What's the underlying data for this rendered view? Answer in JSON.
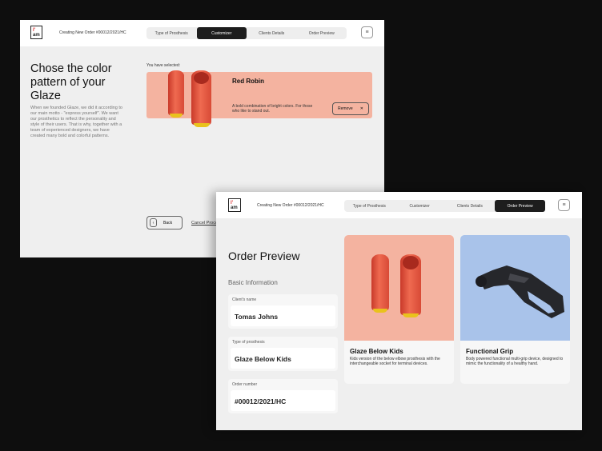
{
  "window1": {
    "logo": "I'am",
    "order_title": "Creating New Order #00012/2021/HC",
    "tabs": [
      "Type of Prosthesis",
      "Customizer",
      "Clients Details",
      "Order Preview"
    ],
    "active_tab": "Customizer",
    "heading": "Chose the color pattern of your Glaze",
    "paragraph": "When we founded Glaze, we did it according to our main motto - \"express yourself\". We want our prosthetics to reflect the personality and style of their users. That is why, together with a team of experienced designers, we have created many bold and colorful patterns.",
    "selected_label": "You have selected:",
    "selected": {
      "name": "Red Robin",
      "description": "A bold combination of bright colors. For those who like to stand out.",
      "remove_label": "Remove",
      "color": "#f4b3a0"
    },
    "back_label": "Back",
    "cancel_label": "Cancel Process"
  },
  "window2": {
    "logo": "I'am",
    "order_title": "Creating New Order #00012/2021/HC",
    "tabs": [
      "Type of Prosthesis",
      "Customizer",
      "Clients Details",
      "Order Preview"
    ],
    "active_tab": "Order Preview",
    "heading": "Order Preview",
    "section": "Basic Information",
    "fields": [
      {
        "label": "Client's name",
        "value": "Tomas Johns"
      },
      {
        "label": "Type of prosthesis",
        "value": "Glaze Below Kids"
      },
      {
        "label": "Order number",
        "value": "#00012/2021/HC"
      }
    ],
    "cards": [
      {
        "title": "Glaze Below Kids",
        "description": "Kids version of the below elbow prosthesis with the interchangeable socket for terminal devices.",
        "color": "#f4b3a0"
      },
      {
        "title": "Functional Grip",
        "description": "Body powered functional multi-grip device, designed to mimic the functionality of a healthy hand.",
        "color": "#a9c3ea"
      }
    ]
  }
}
